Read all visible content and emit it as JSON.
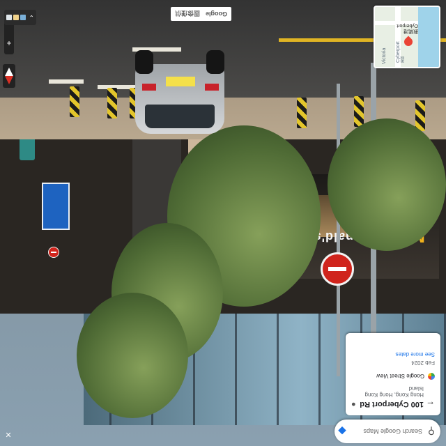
{
  "search": {
    "placeholder": "Search Google Maps"
  },
  "location_card": {
    "title": "100 Cyberport Rd",
    "subtitle": "Hong Kong, Hong Kong Island",
    "source": "Google Street View",
    "date": "Feb 2024",
    "more_dates": "See more dates"
  },
  "minimap": {
    "place_label_zh": "數碼港",
    "place_label_en": "Cyberport",
    "road_1": "Cyberport Rd",
    "road_2": "Victoria"
  },
  "attribution": {
    "google": "Google",
    "terms_zh": "圖像僅供"
  },
  "scene": {
    "storefront": "McDonald's"
  },
  "icons": {
    "search": "search-icon",
    "back": "back-arrow-icon",
    "mic": "microphone-icon",
    "zoom_in": "plus-icon",
    "zoom_out": "minus-icon",
    "compass": "compass-icon",
    "expand": "expand-icon",
    "layers": "layers-icon"
  }
}
